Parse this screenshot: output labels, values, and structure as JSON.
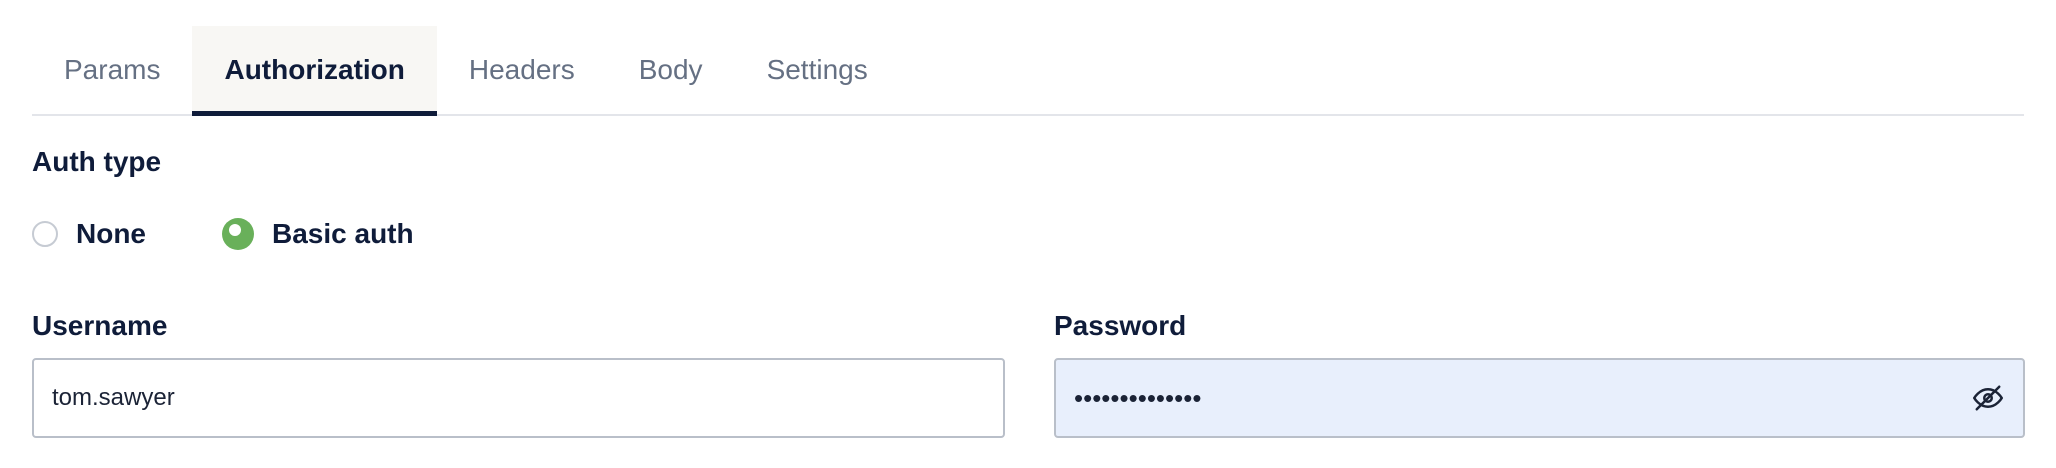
{
  "tabs": [
    {
      "label": "Params"
    },
    {
      "label": "Authorization"
    },
    {
      "label": "Headers"
    },
    {
      "label": "Body"
    },
    {
      "label": "Settings"
    }
  ],
  "active_tab": "Authorization",
  "auth": {
    "label": "Auth type",
    "options": [
      {
        "label": "None",
        "selected": false
      },
      {
        "label": "Basic auth",
        "selected": true
      }
    ]
  },
  "username": {
    "label": "Username",
    "value": "tom.sawyer"
  },
  "password": {
    "label": "Password",
    "masked_value": "••••••••••••••",
    "icon": "eye-slash-icon"
  },
  "colors": {
    "text_primary": "#0f1c3a",
    "text_muted": "#657083",
    "radio_selected": "#69b05a",
    "password_bg": "#e8effc"
  }
}
